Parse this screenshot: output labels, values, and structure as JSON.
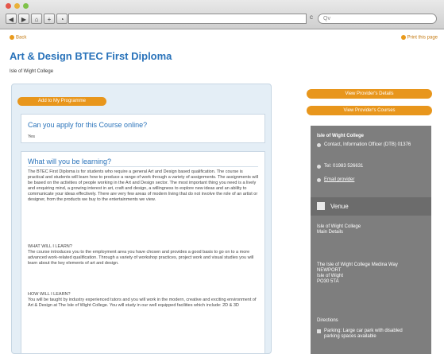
{
  "browser": {
    "nav_icons": [
      "back-icon",
      "forward-icon",
      "home-icon",
      "add-icon",
      "rss-icon"
    ],
    "reload_glyph": "c",
    "search_placeholder": "Qv"
  },
  "header": {
    "back_label": "Back",
    "print_label": "Print this page",
    "title": "Art & Design BTEC First Diploma",
    "subtitle": "Isle of Wight College"
  },
  "main": {
    "add_button": "Add to My Programme",
    "apply_heading": "Can you apply for this Course online?",
    "apply_answer": "Yes",
    "learning_heading": "What will you be learning?",
    "para1": "The BTEC First Diploma is for students who require a general Art and Design based qualification. The course is practical and students will learn how to produce a range of work through a variety of assignments. The assignments will be based on the activities of people working in the Art and Design sector. The most important thing you need is a lively and enquiring mind, a growing interest in art, craft and design, a willingness to explore new ideas and an ability to communicate your ideas effectively. There are very few areas of modern living that do not involve the role of an artist or designer, from the products we buy to the entertainments we view.",
    "what_heading": "WHAT WILL I LEARN?",
    "para2": "The course introduces you to the employment area you have chosen and provides a good basis to go on to a more advanced work-related qualification. Through a variety of workshop practices, project work and visual studies you will learn about the key elements of art and design.",
    "how_heading": "HOW WILL I LEARN?",
    "para3": "You will be taught by industry experienced tutors and you will work in the modern, creative and exciting environment of Art & Design at The Isle of Wight College. You will study in our well equipped facilities which include: 2D & 3D"
  },
  "sidebar": {
    "view_details": "View Provider's Details",
    "view_courses": "View Provider's Courses",
    "provider_name": "Isle of Wight College",
    "contact": "Contact, Information Officer (DTB) 01376",
    "tel": "Tel: 01983 526631",
    "email": "Email provider",
    "venue_label": "Venue",
    "venue_block1": "Isle of Wight College\nMain Details",
    "venue_block2": "The Isle of Wight College Medina Way\nNEWPORT\nIsle of Wight\nPO30 5TA",
    "directions_label": "Directions",
    "directions_text": "Parking: Large car park with disabled parking spaces available"
  },
  "colors": {
    "accent_orange": "#e8961c",
    "heading_blue": "#2a73ba",
    "panel_grey": "#7e7e7e"
  }
}
